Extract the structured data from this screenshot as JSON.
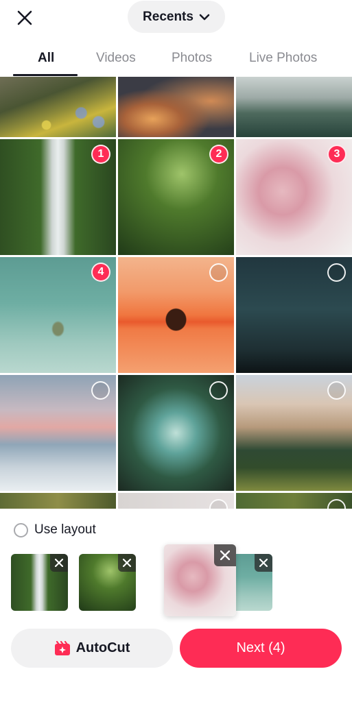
{
  "header": {
    "album_label": "Recents"
  },
  "tabs": [
    {
      "label": "All",
      "active": true
    },
    {
      "label": "Videos",
      "active": false
    },
    {
      "label": "Photos",
      "active": false
    },
    {
      "label": "Live Photos",
      "active": false
    }
  ],
  "grid": {
    "badges": [
      "1",
      "2",
      "3",
      "4"
    ]
  },
  "sheet": {
    "use_layout_label": "Use layout",
    "autocut_label": "AutoCut",
    "next_label": "Next (4)"
  },
  "colors": {
    "accent": "#fe2c55",
    "pill_bg": "#f1f1f2",
    "text_primary": "#161823",
    "text_secondary": "#8a8b91"
  },
  "icons": [
    "close-icon",
    "chevron-down-icon",
    "autocut-icon",
    "remove-icon"
  ]
}
